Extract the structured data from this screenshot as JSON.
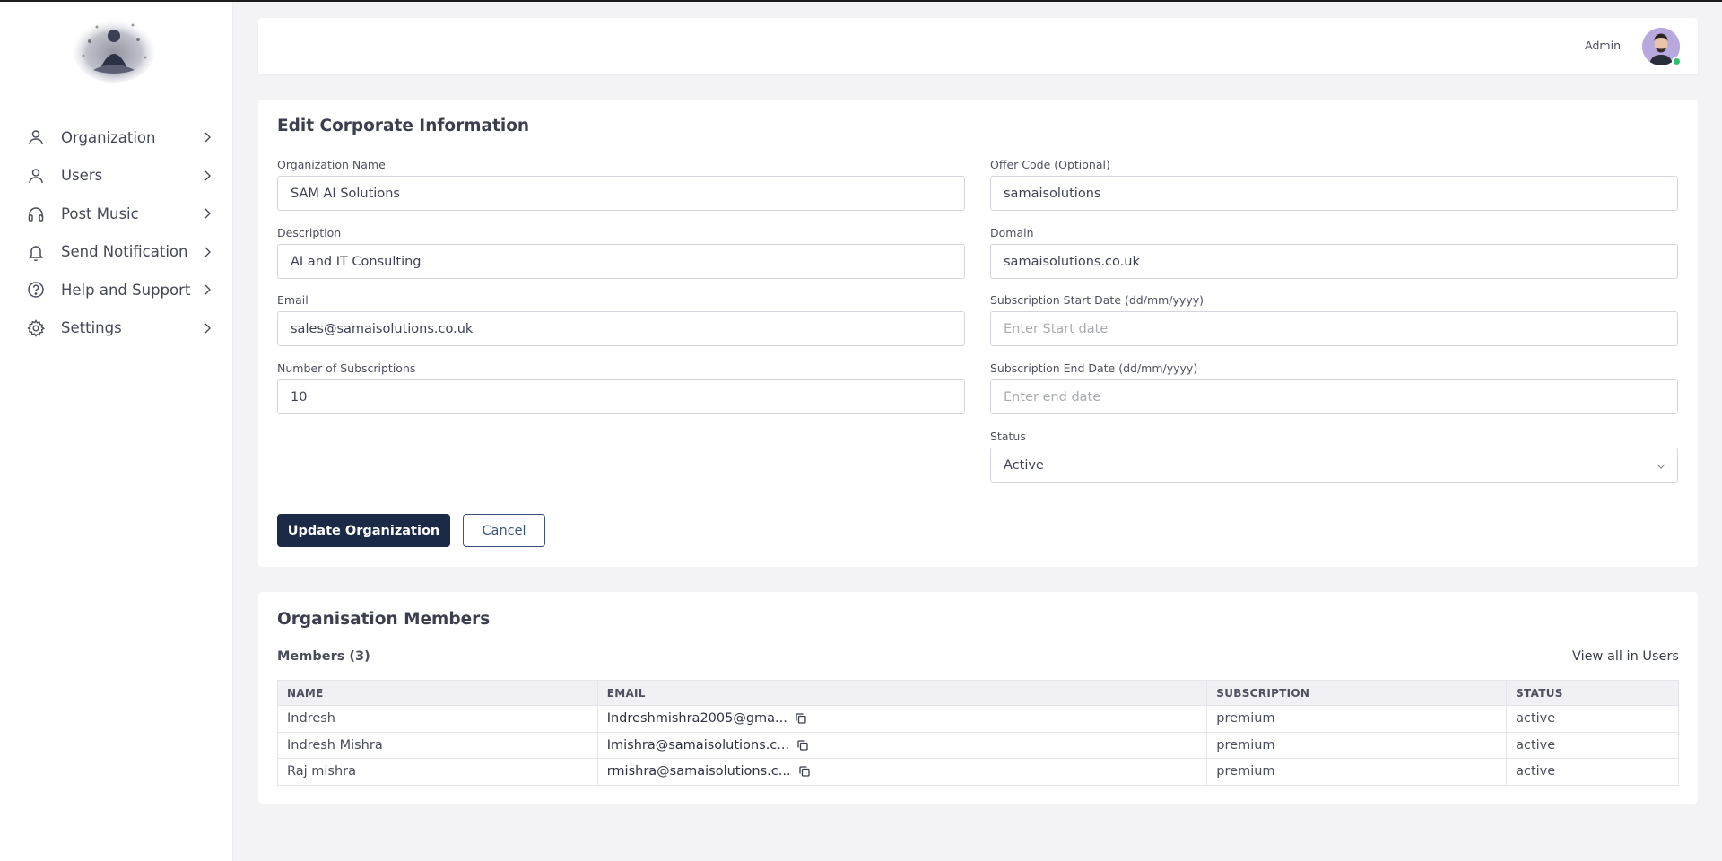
{
  "header": {
    "admin_label": "Admin"
  },
  "sidebar": {
    "items": [
      {
        "label": "Organization",
        "icon": "user-icon"
      },
      {
        "label": "Users",
        "icon": "user-icon"
      },
      {
        "label": "Post Music",
        "icon": "headphones-icon"
      },
      {
        "label": "Send Notification",
        "icon": "bell-icon"
      },
      {
        "label": "Help and Support",
        "icon": "help-circle-icon"
      },
      {
        "label": "Settings",
        "icon": "gear-icon"
      }
    ]
  },
  "form": {
    "title": "Edit Corporate Information",
    "org_name": {
      "label": "Organization Name",
      "value": "SAM AI Solutions"
    },
    "description": {
      "label": "Description",
      "value": "AI and IT Consulting"
    },
    "email": {
      "label": "Email",
      "value": "sales@samaisolutions.co.uk"
    },
    "subscriptions": {
      "label": "Number of Subscriptions",
      "value": "10"
    },
    "offer_code": {
      "label": "Offer Code (Optional)",
      "value": "samaisolutions"
    },
    "domain": {
      "label": "Domain",
      "value": "samaisolutions.co.uk"
    },
    "start_date": {
      "label": "Subscription Start Date (dd/mm/yyyy)",
      "placeholder": "Enter Start date"
    },
    "end_date": {
      "label": "Subscription End Date (dd/mm/yyyy)",
      "placeholder": "Enter end date"
    },
    "status": {
      "label": "Status",
      "value": "Active"
    },
    "update_label": "Update Organization",
    "cancel_label": "Cancel"
  },
  "members": {
    "title": "Organisation Members",
    "count_label": "Members (3)",
    "view_all": "View all in Users",
    "columns": [
      "NAME",
      "EMAIL",
      "SUBSCRIPTION",
      "STATUS"
    ],
    "rows": [
      {
        "name": "Indresh",
        "email": "Indreshmishra2005@gma...",
        "subscription": "premium",
        "status": "active"
      },
      {
        "name": "Indresh Mishra",
        "email": "Imishra@samaisolutions.c...",
        "subscription": "premium",
        "status": "active"
      },
      {
        "name": "Raj mishra",
        "email": "rmishra@samaisolutions.c...",
        "subscription": "premium",
        "status": "active"
      }
    ]
  },
  "colors": {
    "primary_button": "#1b2a47",
    "online_status": "#2ec36b",
    "avatar_bg": "#b7a9de"
  }
}
